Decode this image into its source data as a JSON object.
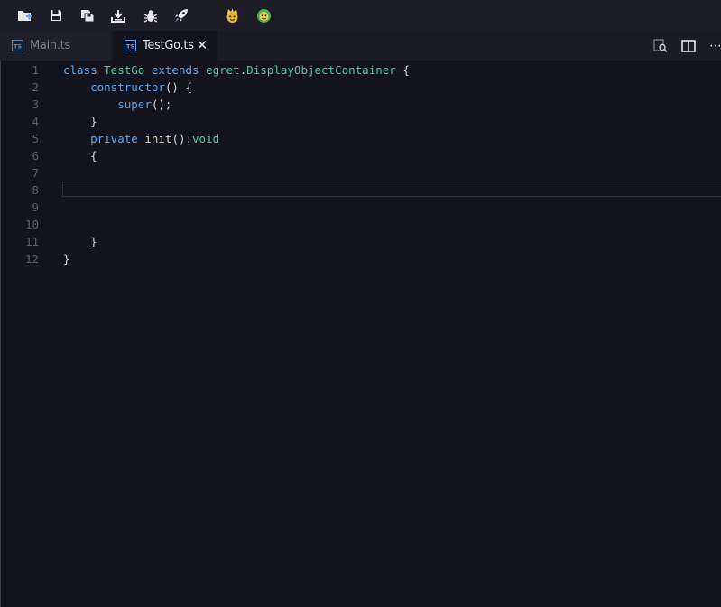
{
  "toolbar": {
    "buttons": [
      {
        "name": "new-project-icon",
        "color": "#e8e8ee"
      },
      {
        "name": "save-icon",
        "color": "#e8e8ee"
      },
      {
        "name": "save-all-icon",
        "color": "#e8e8ee"
      },
      {
        "name": "download-icon",
        "color": "#e8e8ee"
      },
      {
        "name": "debug-bug-icon",
        "color": "#e8e8ee"
      },
      {
        "name": "launch-rocket-icon",
        "color": "#e8e8ee"
      },
      {
        "name": "yellow-character-icon",
        "color": "#e7b530"
      },
      {
        "name": "green-character-icon",
        "color": "#4caf50"
      }
    ]
  },
  "tabs": [
    {
      "label": "Main.ts",
      "active": false,
      "icon": "typescript-file-icon"
    },
    {
      "label": "TestGo.ts",
      "active": true,
      "icon": "typescript-file-icon",
      "close": "✕"
    }
  ],
  "tab_actions": {
    "find_icon": "find-in-file-icon",
    "split_icon": "split-editor-icon",
    "more": "⋯"
  },
  "editor": {
    "current_line": 8,
    "lines": [
      {
        "num": "1",
        "tokens": [
          [
            "kw",
            "class "
          ],
          [
            "ty",
            "TestGo "
          ],
          [
            "kw",
            "extends "
          ],
          [
            "ty",
            "egret"
          ],
          [
            "pl",
            "."
          ],
          [
            "ty",
            "DisplayObjectContainer"
          ],
          [
            "pl",
            " {"
          ]
        ]
      },
      {
        "num": "2",
        "tokens": [
          [
            "pl",
            "    "
          ],
          [
            "kw",
            "constructor"
          ],
          [
            "pl",
            "() {"
          ]
        ]
      },
      {
        "num": "3",
        "tokens": [
          [
            "pl",
            "        "
          ],
          [
            "kw",
            "super"
          ],
          [
            "pl",
            "();"
          ]
        ]
      },
      {
        "num": "4",
        "tokens": [
          [
            "pl",
            "    }"
          ]
        ]
      },
      {
        "num": "5",
        "tokens": [
          [
            "pl",
            "    "
          ],
          [
            "kw",
            "private "
          ],
          [
            "fn",
            "init"
          ],
          [
            "pl",
            "():"
          ],
          [
            "ty",
            "void"
          ]
        ]
      },
      {
        "num": "6",
        "tokens": [
          [
            "pl",
            "    {"
          ]
        ]
      },
      {
        "num": "7",
        "tokens": []
      },
      {
        "num": "8",
        "tokens": []
      },
      {
        "num": "9",
        "tokens": []
      },
      {
        "num": "10",
        "tokens": []
      },
      {
        "num": "11",
        "tokens": [
          [
            "pl",
            "    }"
          ]
        ]
      },
      {
        "num": "12",
        "tokens": [
          [
            "pl",
            "}"
          ]
        ]
      }
    ]
  }
}
